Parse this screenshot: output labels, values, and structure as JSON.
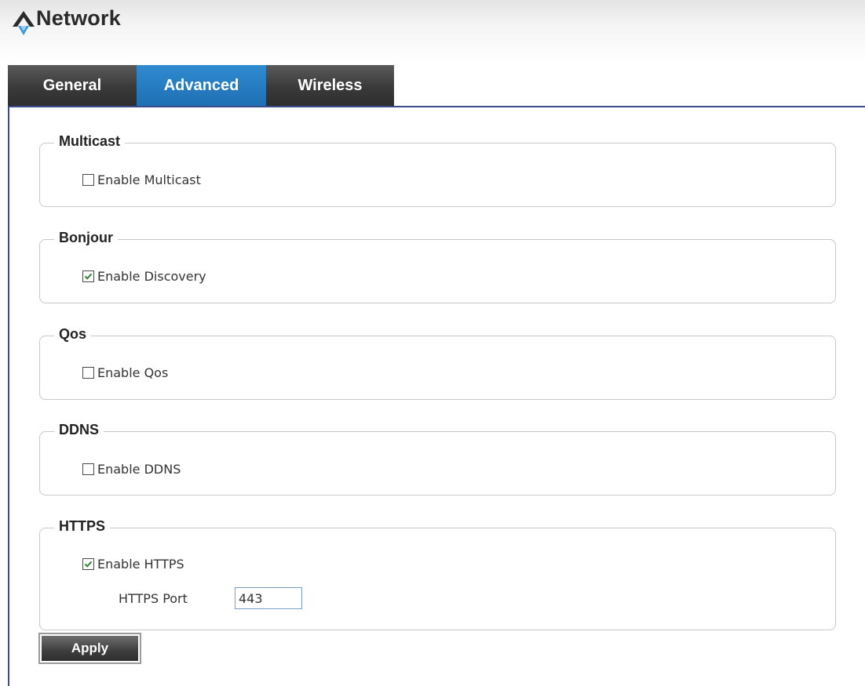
{
  "header": {
    "title": "Network",
    "logo_icon": "network-logo-icon"
  },
  "tabs": [
    {
      "label": "General",
      "active": false
    },
    {
      "label": "Advanced",
      "active": true
    },
    {
      "label": "Wireless",
      "active": false
    }
  ],
  "sections": {
    "multicast": {
      "legend": "Multicast",
      "checkbox_label": "Enable Multicast",
      "checked": false
    },
    "bonjour": {
      "legend": "Bonjour",
      "checkbox_label": "Enable Discovery",
      "checked": true
    },
    "qos": {
      "legend": "Qos",
      "checkbox_label": "Enable Qos",
      "checked": false
    },
    "ddns": {
      "legend": "DDNS",
      "checkbox_label": "Enable DDNS",
      "checked": false
    },
    "https": {
      "legend": "HTTPS",
      "checkbox_label": "Enable HTTPS",
      "checked": true,
      "port_label": "HTTPS Port",
      "port_value": "443"
    }
  },
  "apply_label": "Apply",
  "colors": {
    "accent_tab": "#1f6fb3",
    "check": "#2e8b2e",
    "panel_border": "#3a4a8a"
  }
}
